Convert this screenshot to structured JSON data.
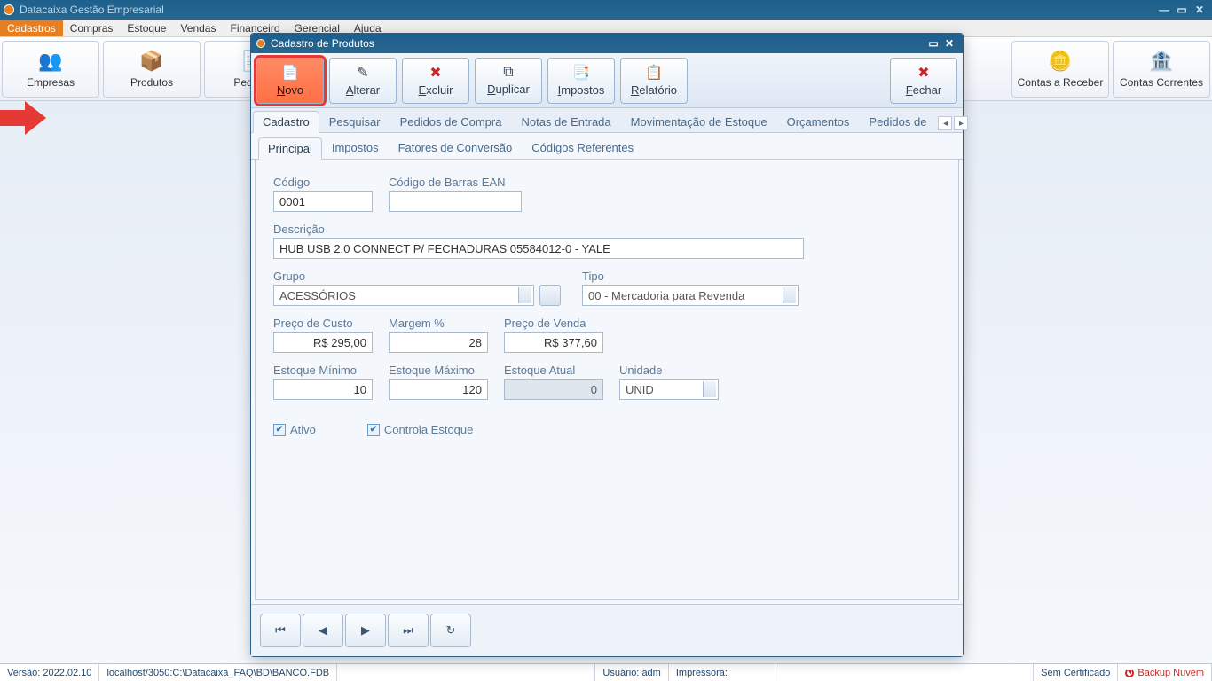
{
  "app": {
    "title": "Datacaixa Gestão Empresarial"
  },
  "menubar": {
    "items": [
      "Cadastros",
      "Compras",
      "Estoque",
      "Vendas",
      "Financeiro",
      "Gerencial",
      "Ajuda"
    ],
    "active_index": 0
  },
  "toolbar": {
    "empresas": "Empresas",
    "produtos": "Produtos",
    "pedidos": "Pedidos",
    "contas_receber": "Contas a Receber",
    "contas_correntes": "Contas Correntes"
  },
  "dialog": {
    "title": "Cadastro de Produtos",
    "buttons": {
      "novo": "Novo",
      "alterar": "Alterar",
      "excluir": "Excluir",
      "duplicar": "Duplicar",
      "impostos": "Impostos",
      "relatorio": "Relatório",
      "fechar": "Fechar"
    },
    "tabs": [
      "Cadastro",
      "Pesquisar",
      "Pedidos de Compra",
      "Notas de Entrada",
      "Movimentação de Estoque",
      "Orçamentos",
      "Pedidos de"
    ],
    "subtabs": [
      "Principal",
      "Impostos",
      "Fatores de Conversão",
      "Códigos Referentes"
    ]
  },
  "form": {
    "codigo_label": "Código",
    "codigo": "0001",
    "ean_label": "Código de Barras EAN",
    "ean": "",
    "descricao_label": "Descrição",
    "descricao": "HUB USB 2.0 CONNECT P/ FECHADURAS 05584012-0 - YALE",
    "grupo_label": "Grupo",
    "grupo": "ACESSÓRIOS",
    "tipo_label": "Tipo",
    "tipo": "00 - Mercadoria para Revenda",
    "preco_custo_label": "Preço de Custo",
    "preco_custo": "R$ 295,00",
    "margem_label": "Margem %",
    "margem": "28",
    "preco_venda_label": "Preço de Venda",
    "preco_venda": "R$ 377,60",
    "est_min_label": "Estoque Mínimo",
    "est_min": "10",
    "est_max_label": "Estoque Máximo",
    "est_max": "120",
    "est_atual_label": "Estoque Atual",
    "est_atual": "0",
    "unidade_label": "Unidade",
    "unidade": "UNID",
    "ativo_label": "Ativo",
    "controla_label": "Controla Estoque"
  },
  "status": {
    "versao_label": "Versão:",
    "versao": "2022.02.10",
    "db": "localhost/3050:C:\\Datacaixa_FAQ\\BD\\BANCO.FDB",
    "usuario_label": "Usuário:",
    "usuario": "adm",
    "impressora_label": "Impressora:",
    "certificado": "Sem Certificado",
    "backup": "Backup Nuvem"
  }
}
